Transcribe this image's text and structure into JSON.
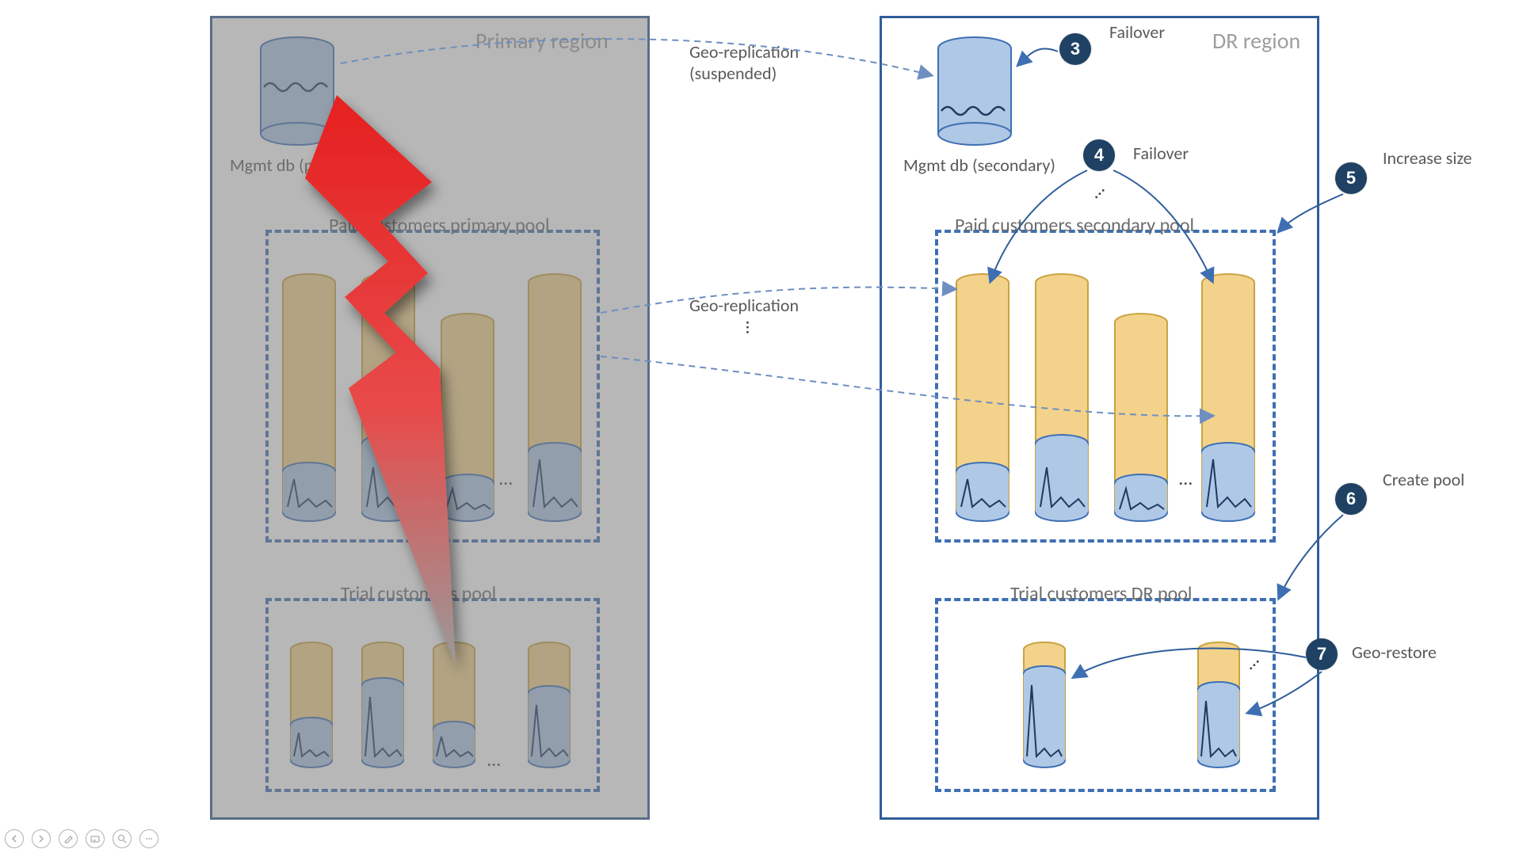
{
  "primary": {
    "title": "Primary region",
    "mgmt_label": "Mgmt db (primary)",
    "paid_pool_label": "Paid customers primary pool",
    "trial_pool_label": "Trial customers pool"
  },
  "dr": {
    "title": "DR region",
    "mgmt_label": "Mgmt db (secondary)",
    "paid_pool_label": "Paid customers secondary pool",
    "trial_pool_label": "Trial customers DR pool"
  },
  "connectors": {
    "geo_rep_suspended": "Geo-replication\n(suspended)",
    "geo_rep": "Geo-replication"
  },
  "steps": {
    "s3": "3",
    "s3_label": "Failover",
    "s4": "4",
    "s4_label": "Failover",
    "s5": "5",
    "s5_label": "Increase size",
    "s6": "6",
    "s6_label": "Create pool",
    "s7": "7",
    "s7_label": "Geo-restore"
  },
  "misc": {
    "dots": "…"
  },
  "controls": {
    "prev": "prev-slide",
    "next": "next-slide",
    "pen": "pen-tool",
    "subtitles": "subtitles",
    "zoom": "zoom",
    "more": "more-options"
  }
}
